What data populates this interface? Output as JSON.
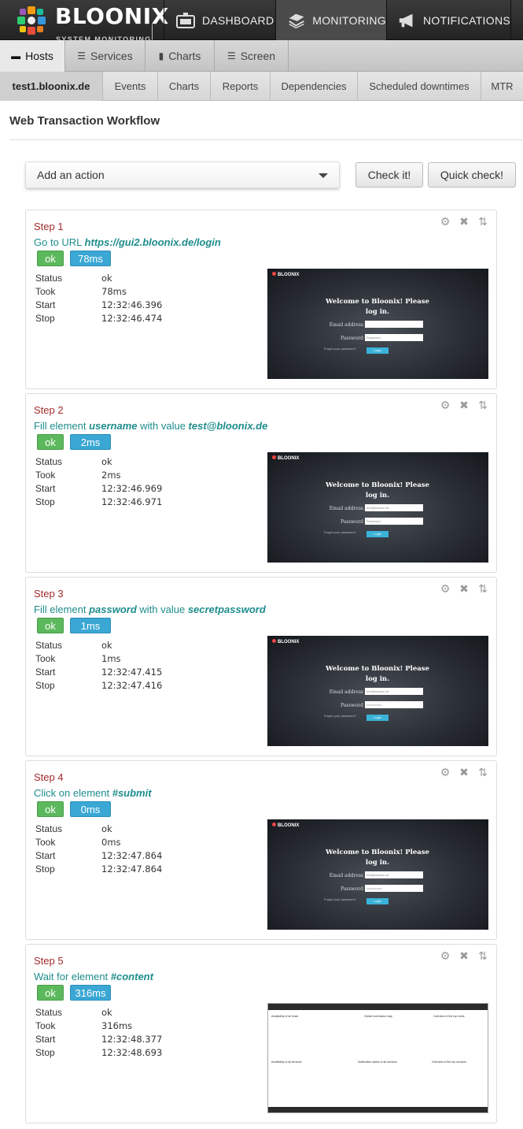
{
  "app": {
    "name": "BLOONIX",
    "tagline": "SYSTEM MONITORING"
  },
  "topnav": [
    {
      "label": "DASHBOARD",
      "icon": "dashboard-icon"
    },
    {
      "label": "MONITORING",
      "icon": "monitoring-icon"
    },
    {
      "label": "NOTIFICATIONS",
      "icon": "megaphone-icon"
    }
  ],
  "tabs": [
    {
      "label": "Hosts",
      "icon": "hosts-icon"
    },
    {
      "label": "Services",
      "icon": "grid-icon"
    },
    {
      "label": "Charts",
      "icon": "bar-chart-icon"
    },
    {
      "label": "Screen",
      "icon": "screen-icon"
    }
  ],
  "subtabs": [
    "test1.bloonix.de",
    "Events",
    "Charts",
    "Reports",
    "Dependencies",
    "Scheduled downtimes",
    "MTR"
  ],
  "page": {
    "title": "Web Transaction Workflow"
  },
  "actions": {
    "select_placeholder": "Add an action",
    "check_label": "Check it!",
    "quick_check_label": "Quick check!"
  },
  "labels": {
    "status": "Status",
    "took": "Took",
    "start": "Start",
    "stop": "Stop"
  },
  "login_screen": {
    "logo": "BLOONIX",
    "welcome": "Welcome to Bloonix! Please log in.",
    "email_label": "Email address",
    "password_label": "Password",
    "password_placeholder": "Password",
    "forgot": "Forgot your password?",
    "login_button": "Login",
    "email_value": "test@bloonix.de",
    "password_value": "••••••••••••••"
  },
  "dashboard_screen": {
    "availability": "Availability of all hosts",
    "global_status": "Global host status map",
    "overview": "Overview of the top hosts",
    "availability_services": "Availability of all services",
    "notification_status": "Notification status of all services",
    "overview_services": "Overview of the top services"
  },
  "colors": {
    "ok": "#5cb85c",
    "time": "#3aa7d4",
    "step_number": "#a12b2b",
    "step_desc": "#1e8c8c"
  },
  "steps": [
    {
      "number": "Step 1",
      "desc_prefix": "Go to URL ",
      "desc_b1": "https://gui2.bloonix.de/login",
      "desc_mid": "",
      "desc_b2": "",
      "ok": "ok",
      "time": "78ms",
      "status": "ok",
      "took": "78ms",
      "start": "12:32:46.396",
      "stop": "12:32:46.474"
    },
    {
      "number": "Step 2",
      "desc_prefix": "Fill element ",
      "desc_b1": "username",
      "desc_mid": " with value ",
      "desc_b2": "test@bloonix.de",
      "ok": "ok",
      "time": "2ms",
      "status": "ok",
      "took": "2ms",
      "start": "12:32:46.969",
      "stop": "12:32:46.971"
    },
    {
      "number": "Step 3",
      "desc_prefix": "Fill element ",
      "desc_b1": "password",
      "desc_mid": " with value ",
      "desc_b2": "secretpassword",
      "ok": "ok",
      "time": "1ms",
      "status": "ok",
      "took": "1ms",
      "start": "12:32:47.415",
      "stop": "12:32:47.416"
    },
    {
      "number": "Step 4",
      "desc_prefix": "Click on element ",
      "desc_b1": "#submit",
      "desc_mid": "",
      "desc_b2": "",
      "ok": "ok",
      "time": "0ms",
      "status": "ok",
      "took": "0ms",
      "start": "12:32:47.864",
      "stop": "12:32:47.864"
    },
    {
      "number": "Step 5",
      "desc_prefix": "Wait for element ",
      "desc_b1": "#content",
      "desc_mid": "",
      "desc_b2": "",
      "ok": "ok",
      "time": "316ms",
      "status": "ok",
      "took": "316ms",
      "start": "12:32:48.377",
      "stop": "12:32:48.693"
    }
  ]
}
